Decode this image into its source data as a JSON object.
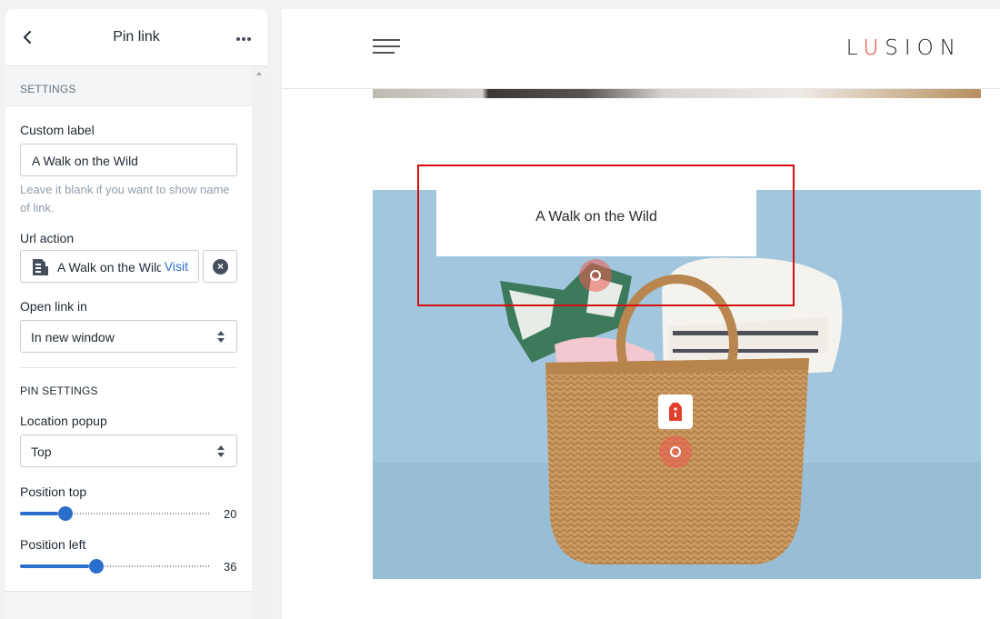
{
  "sidebar": {
    "title": "Pin link",
    "settings_heading": "SETTINGS",
    "custom_label": {
      "label": "Custom label",
      "value": "A Walk on the Wild",
      "help": "Leave it blank if you want to show name of link."
    },
    "url_action": {
      "label": "Url action",
      "value": "A Walk on the Wild",
      "visit_label": "Visit"
    },
    "open_link": {
      "label": "Open link in",
      "value": "In new window"
    },
    "pin_settings_heading": "PIN SETTINGS",
    "location_popup": {
      "label": "Location popup",
      "value": "Top"
    },
    "position_top": {
      "label": "Position top",
      "value": "20",
      "fraction": 0.2
    },
    "position_left": {
      "label": "Position left",
      "value": "36",
      "fraction": 0.36
    }
  },
  "preview": {
    "logo_first": "L",
    "logo_accent": "U",
    "logo_rest": "SION",
    "popup_text": "A Walk on the Wild"
  },
  "colors": {
    "accent_blue": "#2c6ecb",
    "highlight_red": "#d60d0d",
    "logo_accent": "#e2402c",
    "pin": "#f05a50"
  },
  "icons": [
    "back-arrow-icon",
    "more-horizontal-icon",
    "document-icon",
    "clear-circle-icon",
    "select-caret-icon",
    "hamburger-menu-icon",
    "pin-hotspot-icon",
    "price-tag-icon"
  ]
}
